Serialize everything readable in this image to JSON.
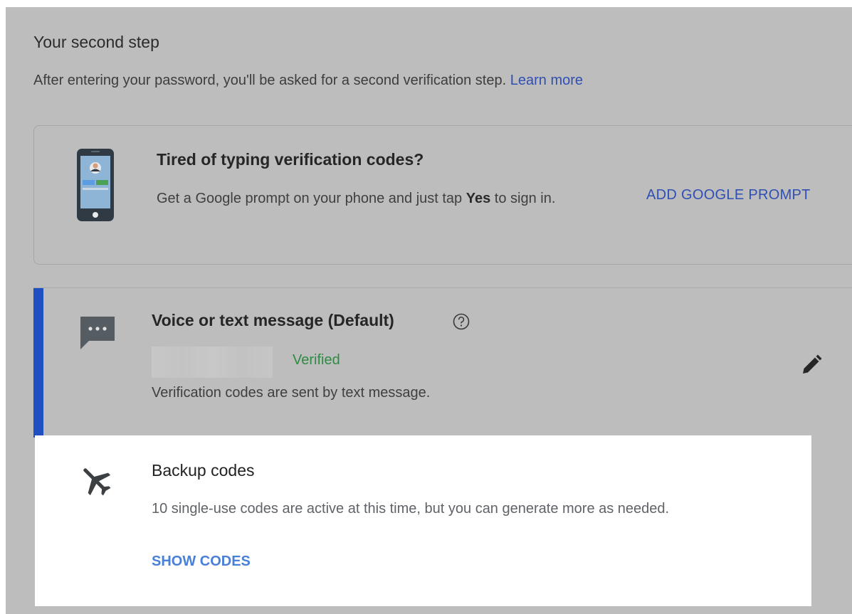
{
  "section": {
    "title": "Your second step",
    "intro": "After entering your password, you'll be asked for a second verification step.",
    "learn_more": "Learn more"
  },
  "prompt_card": {
    "title": "Tired of typing verification codes?",
    "desc_before": "Get a Google prompt on your phone and just tap",
    "desc_bold": "Yes",
    "desc_after": "to sign in.",
    "action": "ADD GOOGLE PROMPT",
    "icon": "phone-illustration-icon"
  },
  "voice_card": {
    "title": "Voice or text message (Default)",
    "status": "Verified",
    "desc": "Verification codes are sent by text message.",
    "icon": "chat-bubble-icon",
    "accent_color": "#1f4fc0",
    "status_color": "#2e8b44"
  },
  "backup_card": {
    "title": "Backup codes",
    "desc": "10 single-use codes are active at this time, but you can generate more as needed.",
    "action": "SHOW CODES",
    "icon": "airplane-icon"
  },
  "colors": {
    "link": "#2f4fb3",
    "dimmed_overlay": "#bdbdbd"
  }
}
